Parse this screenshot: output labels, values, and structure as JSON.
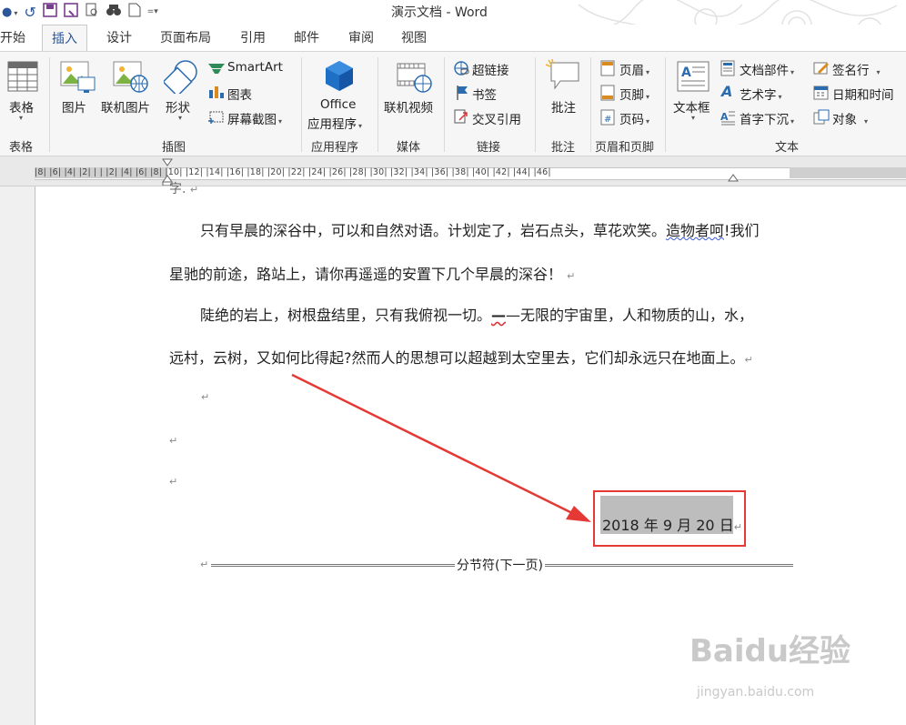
{
  "window": {
    "title": "演示文档 - Word"
  },
  "tabs": [
    "开始",
    "插入",
    "设计",
    "页面布局",
    "引用",
    "邮件",
    "审阅",
    "视图"
  ],
  "ribbon": {
    "table": {
      "label": "表格",
      "group": "表格"
    },
    "illustrations": {
      "group": "插图",
      "picture": "图片",
      "online_picture": "联机图片",
      "shapes": "形状",
      "smartart": "SmartArt",
      "chart": "图表",
      "screenshot": "屏幕截图"
    },
    "apps": {
      "group": "应用程序",
      "line1": "Office",
      "line2": "应用程序"
    },
    "media": {
      "group": "媒体",
      "online_video": "联机视频"
    },
    "links": {
      "group": "链接",
      "hyperlink": "超链接",
      "bookmark": "书签",
      "cross_reference": "交叉引用"
    },
    "comments": {
      "group": "批注",
      "comment": "批注"
    },
    "header_footer": {
      "group": "页眉和页脚",
      "header": "页眉",
      "footer": "页脚",
      "page_number": "页码"
    },
    "text": {
      "group": "文本",
      "textbox": "文本框",
      "quick_parts": "文档部件",
      "wordart": "艺术字",
      "dropcap": "首字下沉",
      "signature": "签名行",
      "datetime": "日期和时间",
      "object": "对象"
    }
  },
  "ruler": {
    "marks": "|8| |6| |4| |2| |  | |2| |4| |6| |8| |10| |12| |14| |16| |18| |20| |22| |24| |26| |28| |30| |32| |34| |36| |38| |40| |42| |44| |46|"
  },
  "document": {
    "para1_line1": "只有早晨的深谷中，可以和自然对语。计划定了，岩石点头，草花欢笑。",
    "para1_wavy": "造物者呵",
    "para1_line1_end": "!我们",
    "para1_line2": "星驰的前途，路站上，请你再遥遥的安置下几个早晨的深谷！",
    "para2_line1": "陡绝的岩上，树根盘结里，只有我俯视一切。",
    "para2_dash": "—",
    "para2_line1_rest": "—无限的宇宙里，人和物质的山，水，",
    "para2_line2": "远村，云树，又如何比得起?然而人的思想可以超越到太空里去，它们却永远只在地面上。",
    "date": "2018 年 9 月 20 日",
    "section_break": "分节符(下一页)"
  },
  "watermark": {
    "brand": "Baidu经验",
    "url": "jingyan.baidu.com"
  },
  "colors": {
    "accent": "#2b579a",
    "highlight_box": "#e53935",
    "arrow": "#e53935"
  }
}
